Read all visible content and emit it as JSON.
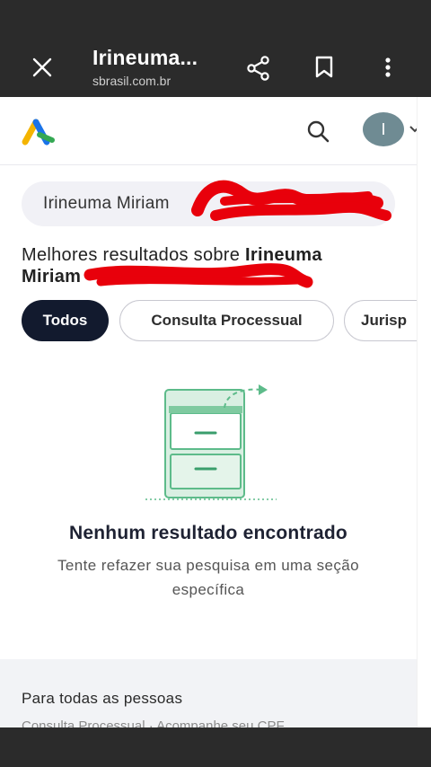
{
  "browser": {
    "title": "Irineuma...",
    "url": "sbrasil.com.br",
    "close_icon": "close-icon",
    "share_icon": "share-icon",
    "bookmark_icon": "bookmark-icon",
    "more_icon": "more-vert-icon"
  },
  "header": {
    "logo_icon": "logo-icon",
    "search_icon": "search-icon",
    "avatar_initial": "I",
    "chevron_icon": "chevron-down-icon"
  },
  "search": {
    "query": "Irineuma Miriam"
  },
  "results": {
    "prefix": "Melhores resultados sobre ",
    "name_line1": "Irineuma",
    "name_line2": "Miriam"
  },
  "chips": [
    {
      "label": "Todos",
      "active": true
    },
    {
      "label": "Consulta Processual",
      "active": false
    },
    {
      "label": "Jurisp",
      "active": false
    }
  ],
  "empty_state": {
    "title": "Nenhum resultado encontrado",
    "description": "Tente refazer sua pesquisa em uma seção específica"
  },
  "footer": {
    "title": "Para todas as pessoas",
    "subtitle": "Consulta Processual  ·  Acompanhe seu CPF"
  },
  "colors": {
    "accent_dark": "#121a2e",
    "illustration_green": "#5dbb8a",
    "redaction_red": "#e8000b"
  }
}
